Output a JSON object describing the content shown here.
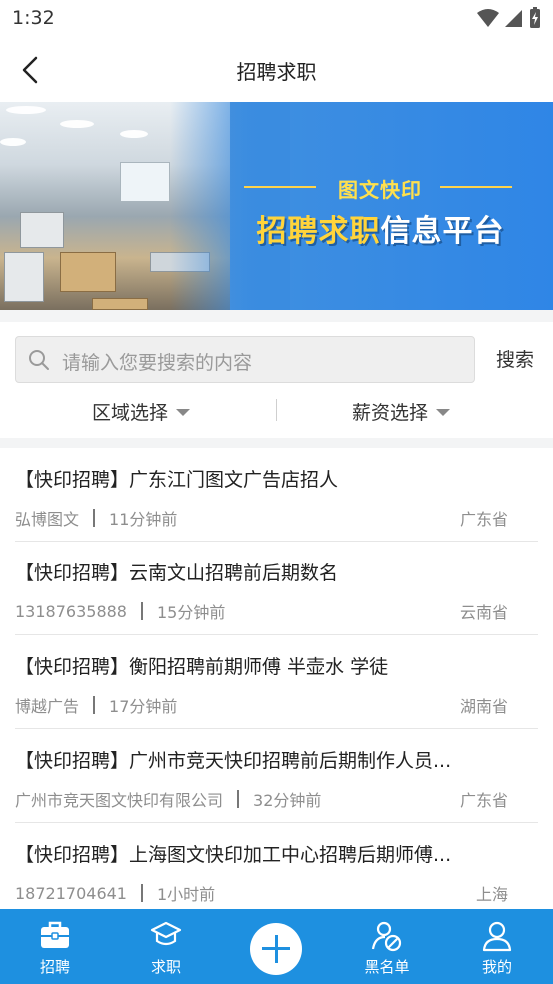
{
  "status_bar": {
    "time": "1:32"
  },
  "header": {
    "title": "招聘求职"
  },
  "banner": {
    "subtitle": "图文快印",
    "title_highlight": "招聘求职",
    "title_rest": "信息平台"
  },
  "search": {
    "placeholder": "请输入您要搜索的内容",
    "button_label": "搜索"
  },
  "filters": {
    "region_label": "区域选择",
    "salary_label": "薪资选择"
  },
  "listings": [
    {
      "title": "【快印招聘】广东江门图文广告店招人",
      "company": "弘博图文",
      "time": "11分钟前",
      "region": "广东省"
    },
    {
      "title": "【快印招聘】云南文山招聘前后期数名",
      "company": "13187635888",
      "time": "15分钟前",
      "region": "云南省"
    },
    {
      "title": "【快印招聘】衡阳招聘前期师傅 半壶水 学徒",
      "company": "博越广告",
      "time": "17分钟前",
      "region": "湖南省"
    },
    {
      "title": "【快印招聘】广州市竞天快印招聘前后期制作人员...",
      "company": "广州市竞天图文快印有限公司",
      "time": "32分钟前",
      "region": "广东省"
    },
    {
      "title": "【快印招聘】上海图文快印加工中心招聘后期师傅...",
      "company": "18721704641",
      "time": "1小时前",
      "region": "上海"
    }
  ],
  "bottom_nav": {
    "items": [
      {
        "label": "招聘",
        "icon": "briefcase-icon"
      },
      {
        "label": "求职",
        "icon": "graduation-cap-icon"
      },
      {
        "label": "",
        "icon": "plus-icon"
      },
      {
        "label": "黑名单",
        "icon": "blocked-user-icon"
      },
      {
        "label": "我的",
        "icon": "user-icon"
      }
    ]
  },
  "colors": {
    "accent": "#1e90e0",
    "banner_yellow": "#ffd43b"
  }
}
